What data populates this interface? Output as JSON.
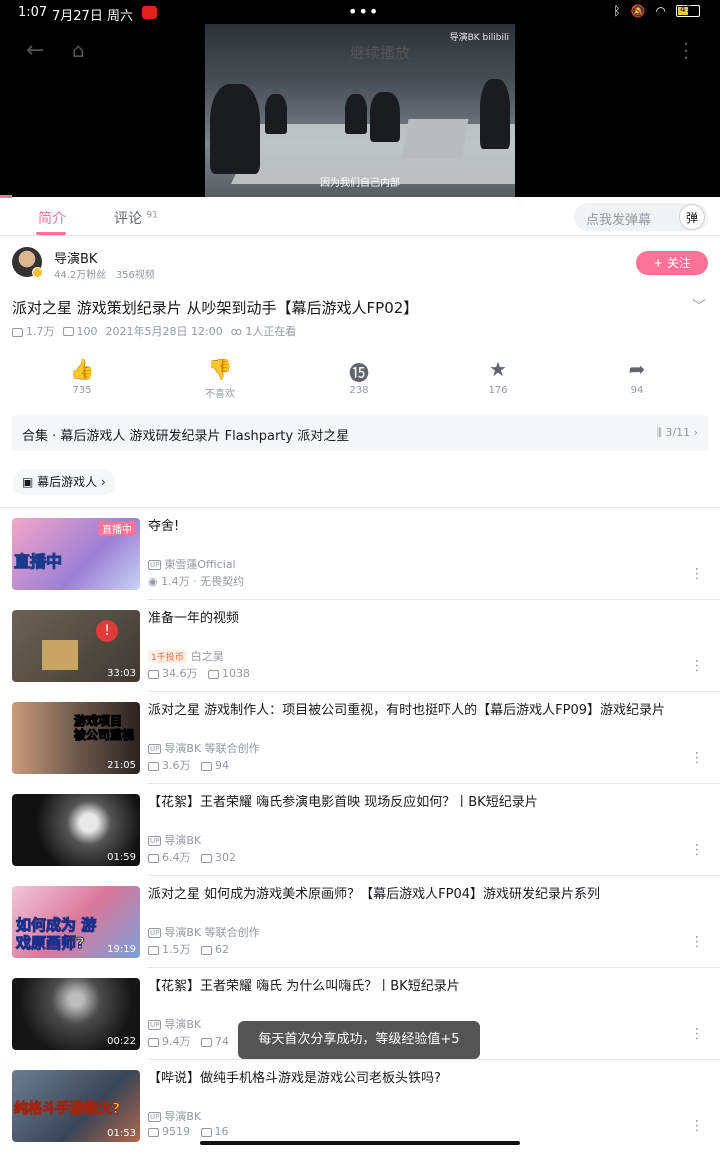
{
  "status": {
    "time": "1:07",
    "date": "7月27日 周六",
    "dots": "•••",
    "battery": "47"
  },
  "player": {
    "brand": "导演BK bilibili",
    "subtitle": "因为我们自己内部",
    "play_text": "继续播放"
  },
  "tabs": [
    {
      "label": "简介"
    },
    {
      "label": "评论",
      "count": "91"
    }
  ],
  "danmaku": {
    "placeholder": "点我发弹幕",
    "btn": "弹"
  },
  "uploader": {
    "name": "导演BK",
    "fans": "44.2万粉丝",
    "videos": "356视频",
    "follow": "+ 关注"
  },
  "video": {
    "title": "派对之星 游戏策划纪录片 从吵架到动手【幕后游戏人FP02】",
    "views": "1.7万",
    "danmaku": "100",
    "date": "2021年5月28日 12:00",
    "watching": "1人正在看"
  },
  "actions": [
    {
      "icon": "like-icon",
      "label": "735"
    },
    {
      "icon": "dislike-icon",
      "label": "不喜欢"
    },
    {
      "icon": "coin-icon",
      "label": "238"
    },
    {
      "icon": "star-icon",
      "label": "176"
    },
    {
      "icon": "share-icon",
      "label": "94"
    }
  ],
  "collection": {
    "title": "合集 · 幕后游戏人 游戏研发纪录片 Flashparty 派对之星",
    "counter": "3/11"
  },
  "tag": "幕后游戏人",
  "recommendations": [
    {
      "title": "夺舍!",
      "uploader": "東雪蓮Official",
      "stats": "1.4万 · 无畏契约",
      "badge": "直播中",
      "overlay": "直播中"
    },
    {
      "title": "准备一年的视频",
      "hot": "1千投币",
      "uploader": "白之昊",
      "views": "34.6万",
      "danmaku": "1038",
      "duration": "33:03"
    },
    {
      "title": "派对之星 游戏制作人：项目被公司重视，有时也挺吓人的【幕后游戏人FP09】游戏纪录片",
      "uploader": "导演BK 等联合创作",
      "views": "3.6万",
      "danmaku": "94",
      "duration": "21:05",
      "overlay": "游戏项目 被公司重视"
    },
    {
      "title": "【花絮】王者荣耀 嗨氏参演电影首映 现场反应如何？丨BK短纪录片",
      "uploader": "导演BK",
      "views": "6.4万",
      "danmaku": "302",
      "duration": "01:59"
    },
    {
      "title": "派对之星 如何成为游戏美术原画师？【幕后游戏人FP04】游戏研发纪录片系列",
      "uploader": "导演BK 等联合创作",
      "views": "1.5万",
      "danmaku": "62",
      "duration": "19:19",
      "overlay": "如何成为 游戏原画师?"
    },
    {
      "title": "【花絮】王者荣耀 嗨氏 为什么叫嗨氏？丨BK短纪录片",
      "uploader": "导演BK",
      "views": "9.4万",
      "danmaku": "74",
      "duration": "00:22"
    },
    {
      "title": "【哔说】做纯手机格斗游戏是游戏公司老板头铁吗?",
      "uploader": "导演BK",
      "views": "9519",
      "danmaku": "16",
      "duration": "01:53",
      "overlay": "纯格斗手游能火?"
    }
  ],
  "toast": "每天首次分享成功，等级经验值+5"
}
